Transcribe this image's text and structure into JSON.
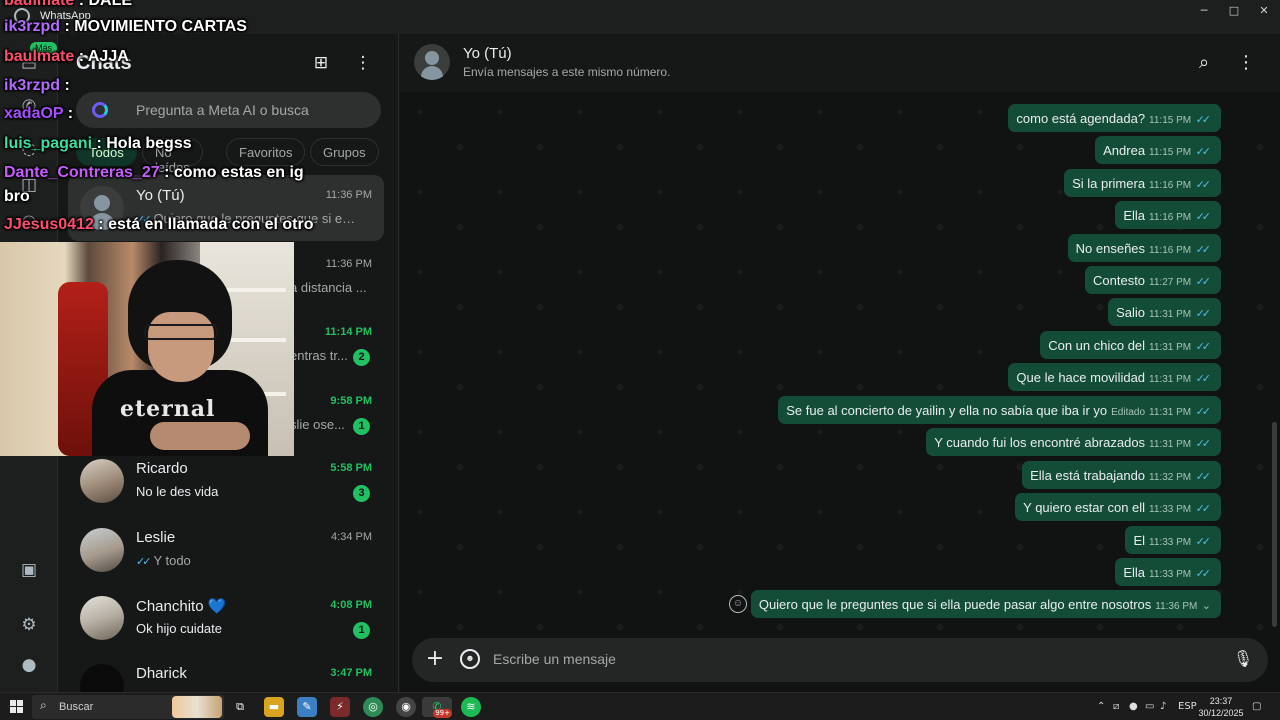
{
  "titlebar": {
    "app_name": "WhatsApp",
    "minimize": "─",
    "maximize": "□",
    "close": "✕"
  },
  "rail": {
    "mas_label": "Más"
  },
  "list": {
    "title": "Chats",
    "search_placeholder": "Pregunta a Meta AI o busca",
    "filters": [
      "Todos",
      "No leídos",
      "Favoritos",
      "Grupos"
    ],
    "chats": [
      {
        "name": "Yo (Tú)",
        "time": "11:36 PM",
        "preview": "Quiero que le preguntes que si ella ...",
        "ticks": true,
        "unread": ""
      },
      {
        "name": "",
        "time": "11:36 PM",
        "preview": "a distancia ...",
        "ticks": false,
        "unread": ""
      },
      {
        "name": "",
        "time": "11:14 PM",
        "preview": "entras tr...",
        "ticks": false,
        "unread": "2"
      },
      {
        "name": "",
        "time": "9:58 PM",
        "preview": "slie ose...",
        "ticks": false,
        "unread": "1"
      },
      {
        "name": "Ricardo",
        "time": "5:58 PM",
        "preview": "No le des vida",
        "ticks": false,
        "unread": "3"
      },
      {
        "name": "Leslie",
        "time": "4:34 PM",
        "preview": "Y todo",
        "ticks": true,
        "unread": ""
      },
      {
        "name": "Chanchito 💙",
        "time": "4:08 PM",
        "preview": "Ok hijo cuidate",
        "ticks": false,
        "unread": "1"
      },
      {
        "name": "Dharick",
        "time": "3:47 PM",
        "preview": "",
        "ticks": false,
        "unread": ""
      }
    ]
  },
  "conversation": {
    "name": "Yo (Tú)",
    "subtitle": "Envía mensajes a este mismo número.",
    "messages": [
      {
        "text": "como está agendada?",
        "time": "11:15 PM",
        "edited": ""
      },
      {
        "text": "Andrea",
        "time": "11:15 PM",
        "edited": ""
      },
      {
        "text": "Si la primera",
        "time": "11:16 PM",
        "edited": ""
      },
      {
        "text": "Ella",
        "time": "11:16 PM",
        "edited": ""
      },
      {
        "text": "No enseñes",
        "time": "11:16 PM",
        "edited": ""
      },
      {
        "text": "Contesto",
        "time": "11:27 PM",
        "edited": ""
      },
      {
        "text": "Salio",
        "time": "11:31 PM",
        "edited": ""
      },
      {
        "text": "Con un chico del",
        "time": "11:31 PM",
        "edited": ""
      },
      {
        "text": "Que le hace movilidad",
        "time": "11:31 PM",
        "edited": ""
      },
      {
        "text": "Se fue al concierto de yailin y ella no sabía que iba ir yo",
        "time": "11:31 PM",
        "edited": "Editado"
      },
      {
        "text": "Y cuando fui los encontré abrazados",
        "time": "11:31 PM",
        "edited": ""
      },
      {
        "text": "Ella está trabajando",
        "time": "11:32 PM",
        "edited": ""
      },
      {
        "text": "Y quiero estar con ell",
        "time": "11:33 PM",
        "edited": ""
      },
      {
        "text": "El",
        "time": "11:33 PM",
        "edited": ""
      },
      {
        "text": "Ella",
        "time": "11:33 PM",
        "edited": ""
      },
      {
        "text": "Quiero que le preguntes que si ella puede pasar algo entre nosotros",
        "time": "11:36 PM",
        "edited": ""
      }
    ],
    "composer_placeholder": "Escribe un mensaje"
  },
  "stream_chat": [
    {
      "user": "baulmate",
      "msg": " : DALE",
      "color": "#ff4d6d"
    },
    {
      "user": "ik3rzpd",
      "msg": " : MOVIMIENTO CARTAS",
      "color": "#b36bff"
    },
    {
      "user": "baulmate",
      "msg": " : AJJA",
      "color": "#ff4d6d"
    },
    {
      "user": "ik3rzpd",
      "msg": " :",
      "color": "#b36bff"
    },
    {
      "user": "xadaOP",
      "msg": " :",
      "color": "#a64dff"
    },
    {
      "user": "luis_pagani",
      "msg": " : Hola begss",
      "color": "#37e0a0"
    },
    {
      "user": "Dante_Contreras_27",
      "msg": " : como estas en ig",
      "color": "#c95cff"
    },
    {
      "user": "",
      "msg": "bro",
      "color": "#ffffff"
    },
    {
      "user": "JJesus0412",
      "msg": " : está en llamada con el otro",
      "color": "#ff4d6d"
    }
  ],
  "webcam": {
    "shirt_text": "eternal"
  },
  "taskbar": {
    "search_label": "Buscar",
    "whatsapp_badge": "99+",
    "lang": "ESP",
    "time": "23:37",
    "date": "30/12/2025"
  },
  "colors": {
    "bubble": "#144d37",
    "accent": "#21c063",
    "read_ticks": "#53bdeb"
  }
}
